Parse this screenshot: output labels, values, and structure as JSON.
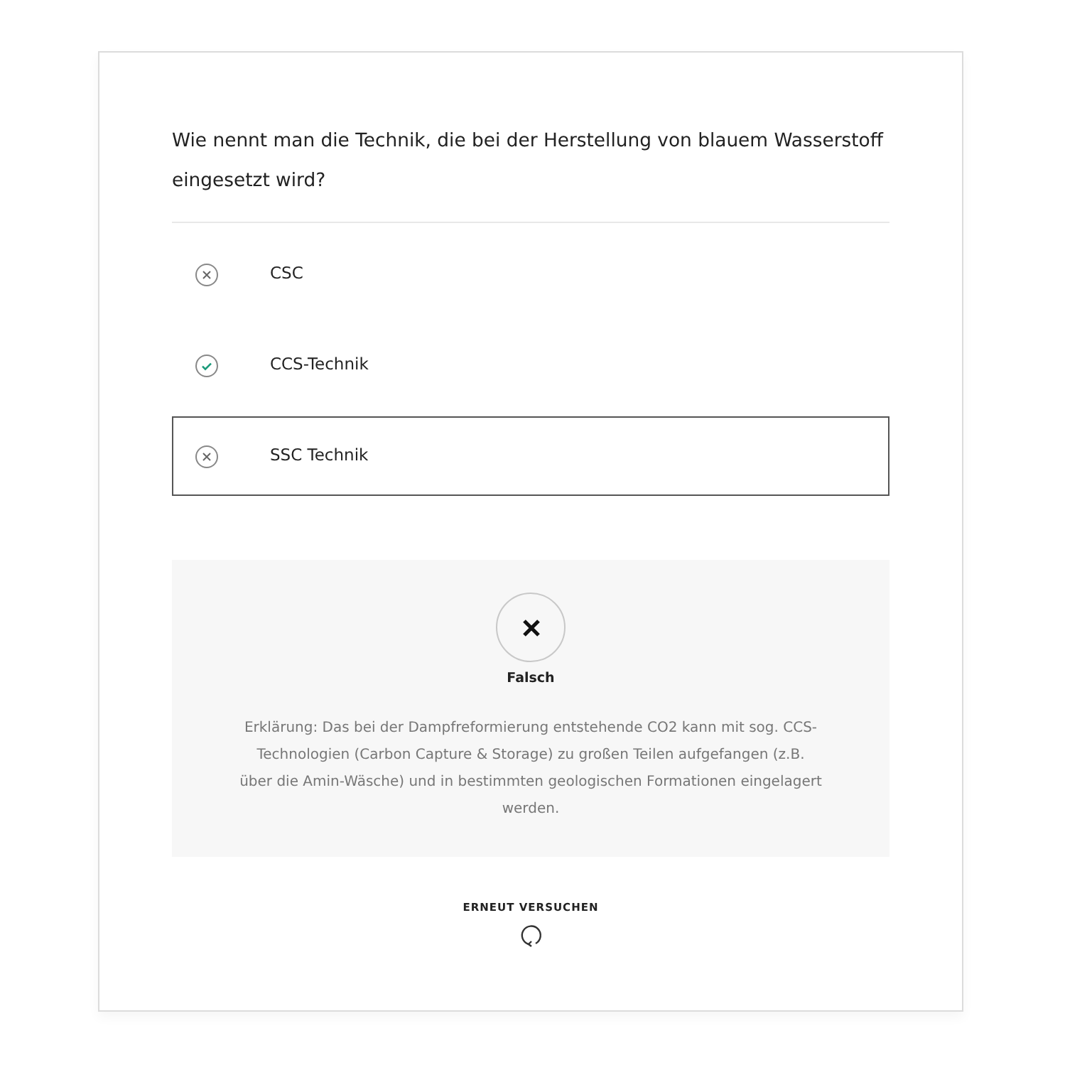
{
  "question": "Wie nennt man die Technik, die bei der Herstellung von blauem Wasserstoff eingesetzt wird?",
  "options": [
    {
      "label": "CSC",
      "correct": false,
      "selected": false
    },
    {
      "label": "CCS-Technik",
      "correct": true,
      "selected": false
    },
    {
      "label": "SSC Technik",
      "correct": false,
      "selected": true
    }
  ],
  "feedback": {
    "result": "Falsch",
    "correct": false,
    "explanation": "Erklärung: Das bei der Dampfreformierung entstehende CO2 kann mit sog. CCS-Technologien (Carbon Capture & Storage) zu großen Teilen aufgefangen (z.B. über die Amin-Wäsche) und in bestimmten geologischen Formationen eingelagert werden."
  },
  "retry_button": "ERNEUT VERSUCHEN"
}
